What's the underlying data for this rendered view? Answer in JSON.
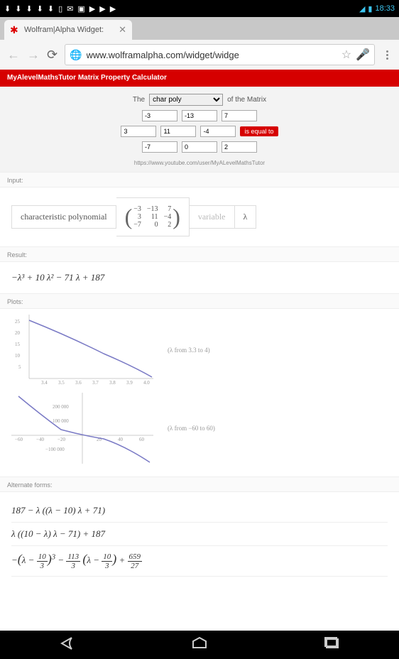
{
  "status": {
    "time": "18:33"
  },
  "tab": {
    "title": "Wolfram|Alpha Widget:"
  },
  "url": "www.wolframalpha.com/widget/widge",
  "widget": {
    "title": "MyAlevelMathsTutor Matrix Property Calculator",
    "label_the": "The",
    "select_value": "char poly",
    "label_ofmatrix": "of the Matrix",
    "matrix": {
      "r1c1": "-3",
      "r1c2": "-13",
      "r1c3": "7",
      "r2c1": "3",
      "r2c2": "11",
      "r2c3": "-4",
      "r3c1": "-7",
      "r3c2": "0",
      "r3c3": "2"
    },
    "equal": "is equal to",
    "link": "https://www.youtube.com/user/MyALevelMathsTutor"
  },
  "sections": {
    "input": "Input:",
    "result": "Result:",
    "plots": "Plots:",
    "alt": "Alternate forms:"
  },
  "interp": {
    "charpoly": "characteristic polynomial",
    "variable": "variable",
    "lambda": "λ",
    "m": {
      "a": "−3",
      "b": "−13",
      "c": "7",
      "d": "3",
      "e": "11",
      "f": "−4",
      "g": "−7",
      "h": "0",
      "i": "2"
    }
  },
  "result": "−λ³ + 10 λ² − 71 λ + 187",
  "plot_captions": {
    "p1": "(λ from 3.3 to 4)",
    "p2": "(λ from −60 to 60)"
  },
  "alt": {
    "a1": "187 − λ ((λ − 10) λ + 71)",
    "a2": "λ ((10 − λ) λ − 71) + 187"
  },
  "chart_data": [
    {
      "type": "line",
      "x": [
        3.3,
        3.4,
        3.5,
        3.6,
        3.7,
        3.8,
        3.9,
        4.0
      ],
      "y": [
        25.5,
        22.8,
        19.8,
        16.6,
        13.2,
        9.5,
        5.5,
        1.0
      ],
      "xlabel": "",
      "ylabel": "",
      "xticks": [
        3.4,
        3.5,
        3.6,
        3.7,
        3.8,
        3.9,
        4.0
      ],
      "yticks": [
        5,
        10,
        15,
        20,
        25
      ],
      "xlim": [
        3.3,
        4.0
      ],
      "ylim": [
        0,
        27
      ]
    },
    {
      "type": "line",
      "x": [
        -60,
        -40,
        -20,
        0,
        20,
        40,
        60
      ],
      "y": [
        256000,
        82000,
        14000,
        187,
        -5000,
        -51000,
        -184000
      ],
      "xlabel": "",
      "ylabel": "",
      "xticks": [
        -60,
        -40,
        -20,
        20,
        40,
        60
      ],
      "yticks": [
        -100000,
        100000,
        200000
      ],
      "xlim": [
        -60,
        60
      ],
      "ylim": [
        -180000,
        260000
      ]
    }
  ]
}
